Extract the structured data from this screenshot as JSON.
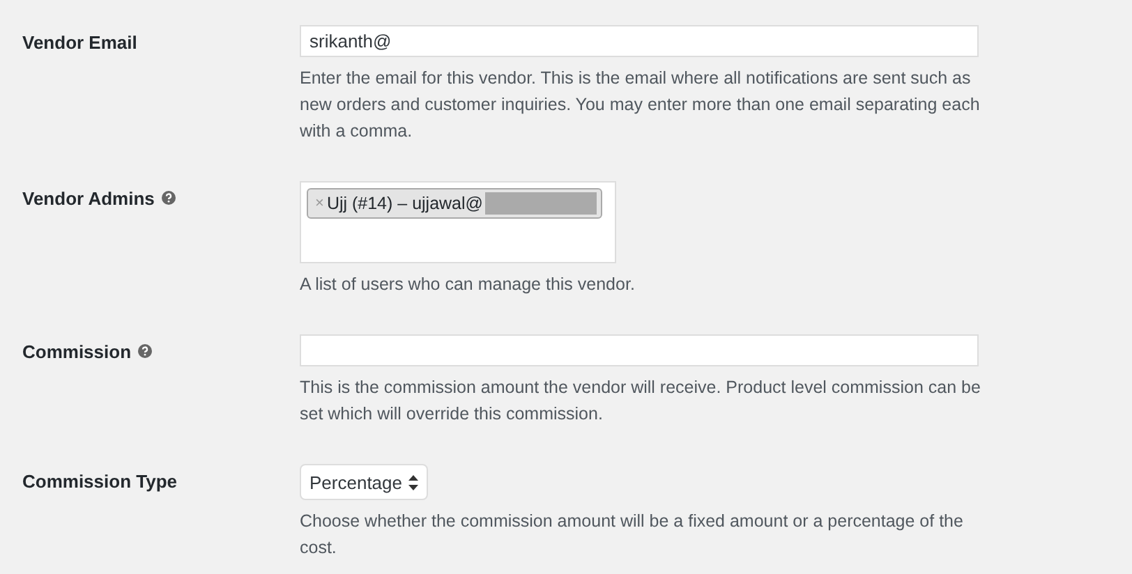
{
  "fields": [
    {
      "kind": "text",
      "label": "Vendor Email",
      "help": false,
      "value": "srikanth@",
      "description": "Enter the email for this vendor. This is the email where all notifications are sent such as new orders and customer inquiries. You may enter more than one email separating each with a comma."
    },
    {
      "kind": "tags",
      "label": "Vendor Admins",
      "help": true,
      "tags": [
        {
          "remove": "×",
          "text": "Ujj (#14) – ujjawal@",
          "redacted": true
        }
      ],
      "description": "A list of users who can manage this vendor."
    },
    {
      "kind": "text",
      "label": "Commission",
      "help": true,
      "description": "This is the commission amount the vendor will receive. Product level commission can be set which will override this commission."
    },
    {
      "kind": "select",
      "label": "Commission Type",
      "help": false,
      "value": "Percentage",
      "description": "Choose whether the commission amount will be a fixed amount or a percentage of the cost."
    }
  ]
}
